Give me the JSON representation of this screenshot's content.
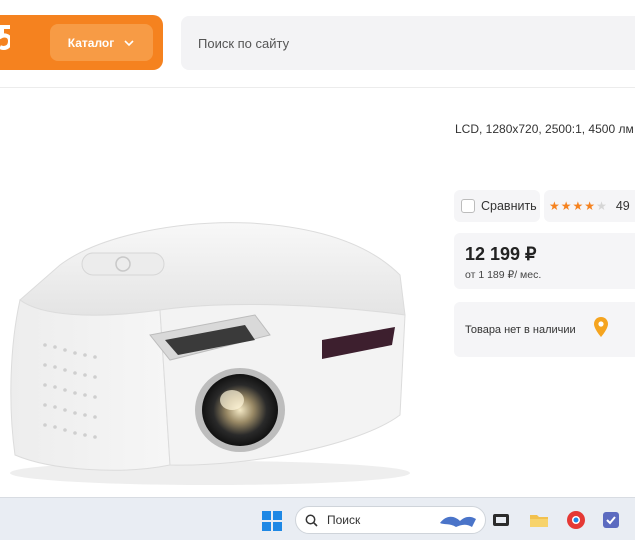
{
  "header": {
    "catalog_label": "Каталог",
    "search_placeholder": "Поиск по сайту"
  },
  "product": {
    "specs": "LCD, 1280x720, 2500:1, 4500 лм",
    "compare_label": "Сравнить",
    "rating_count": "49",
    "rating_value": 4,
    "price": "12 199 ₽",
    "installment": "от 1 189 ₽/ мес.",
    "availability": "Товара нет в наличии"
  },
  "taskbar": {
    "search_label": "Поиск"
  },
  "colors": {
    "brand_orange": "#f5821f",
    "catalog_button": "#f79b45",
    "panel_bg": "#f5f5f7"
  }
}
